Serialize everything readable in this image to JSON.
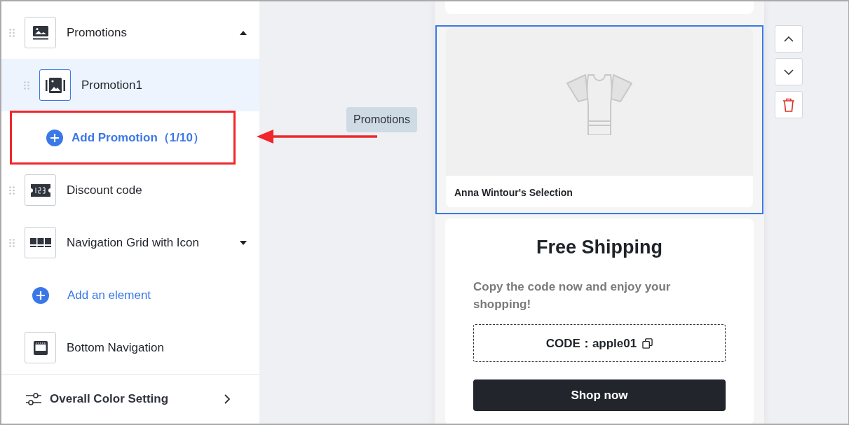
{
  "sidebar": {
    "items": [
      {
        "kind": "banner",
        "label": "Promotions",
        "draggable": true,
        "expanded": true,
        "selected": false
      },
      {
        "kind": "promotion",
        "label": "Promotion1",
        "draggable": true,
        "selected": true
      },
      {
        "kind": "add-child",
        "label": "Add Promotion（1/10）",
        "highlighted": true
      },
      {
        "kind": "discount",
        "label": "Discount code",
        "draggable": true,
        "selected": false
      },
      {
        "kind": "nav-grid",
        "label": "Navigation Grid with Icon",
        "draggable": true,
        "expanded": false,
        "selected": false
      },
      {
        "kind": "add-element",
        "label": "Add an element",
        "highlighted": false
      },
      {
        "kind": "bottom-nav",
        "label": "Bottom Navigation",
        "draggable": false,
        "selected": false
      }
    ],
    "footer": {
      "label": "Overall Color Setting"
    }
  },
  "preview": {
    "tooltip": "Promotions",
    "promotion_card": {
      "caption": "Anna Wintour's Selection",
      "selected": true
    },
    "discount_card": {
      "title": "Free Shipping",
      "text": "Copy the code now and enjoy your shopping!",
      "code": "CODE：apple01",
      "button": "Shop now"
    }
  }
}
